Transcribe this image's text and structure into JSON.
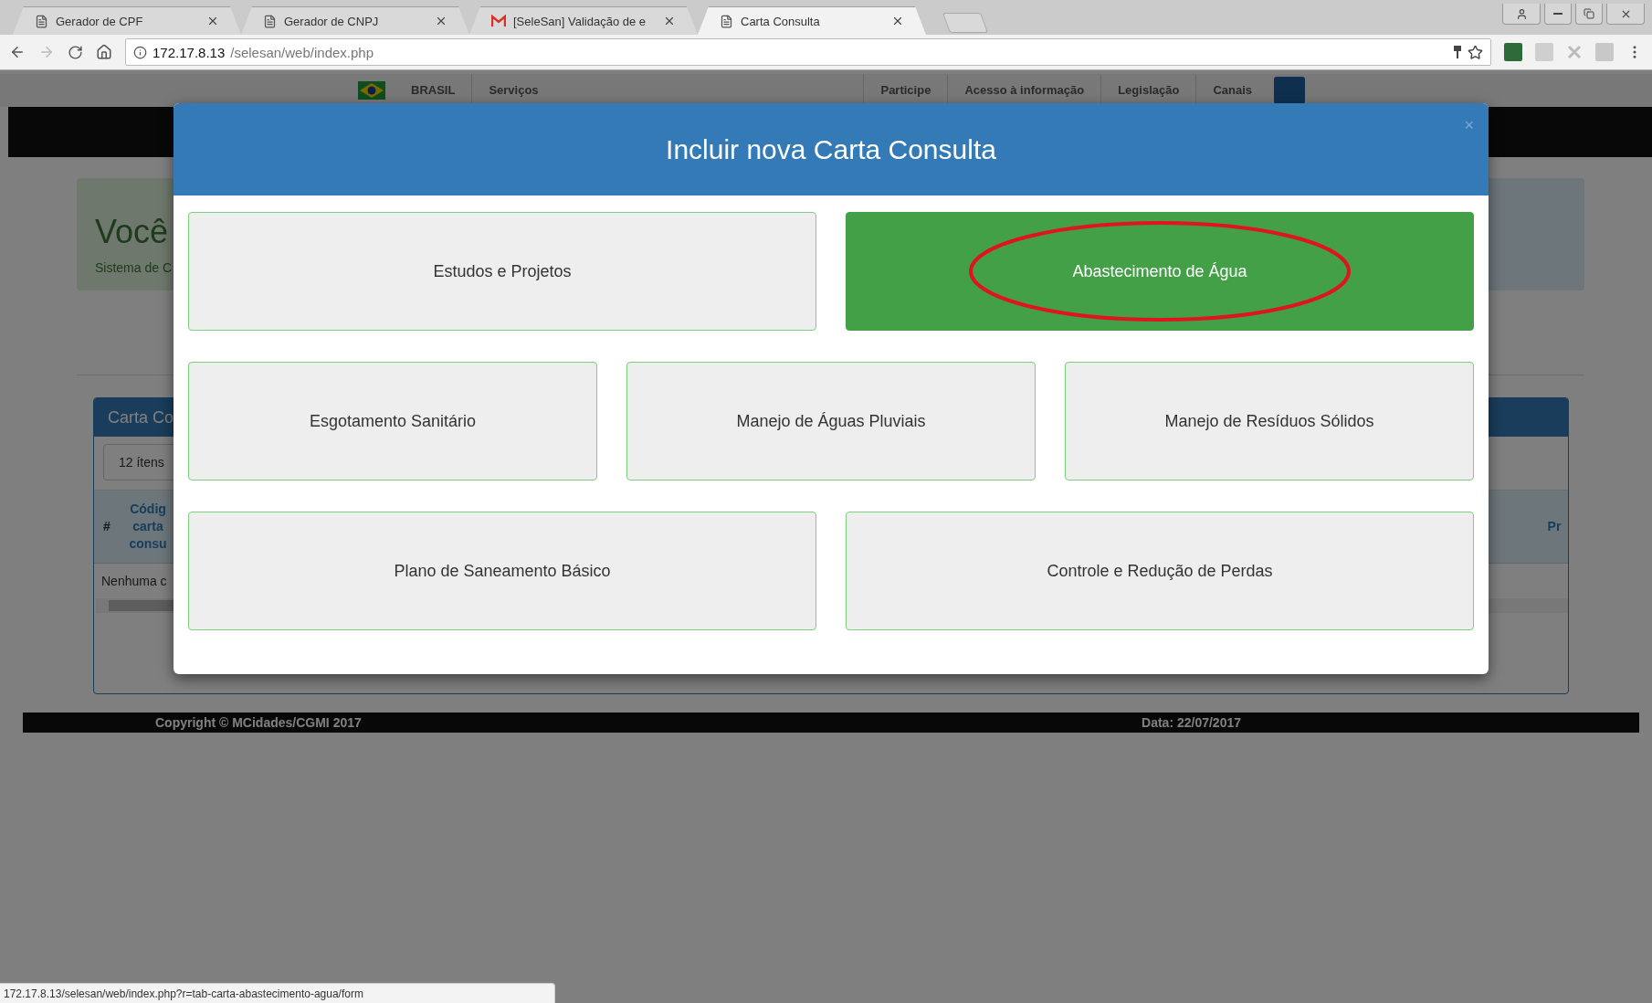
{
  "browser": {
    "tabs": [
      {
        "title": "Gerador de CPF",
        "kind": "page",
        "selected": false
      },
      {
        "title": "Gerador de CNPJ",
        "kind": "page",
        "selected": false
      },
      {
        "title": "[SeleSan] Validação de e",
        "kind": "mail",
        "selected": false
      },
      {
        "title": "Carta Consulta",
        "kind": "page",
        "selected": true
      }
    ],
    "address": {
      "host": "172.17.8.13",
      "path": "/selesan/web/index.php"
    }
  },
  "gov_bar": {
    "brand": "BRASIL",
    "left_links": [
      "Serviços"
    ],
    "right_links": [
      "Participe",
      "Acesso à informação",
      "Legislação",
      "Canais"
    ]
  },
  "page": {
    "welcome": {
      "title": "Você",
      "subtitle": "Sistema de C"
    },
    "panel": {
      "title": "Carta Co",
      "page_size": "12 ítens",
      "columns": [
        "#",
        "Códig carta consu",
        "Pr"
      ],
      "empty_row": "Nenhuma c"
    }
  },
  "footer": {
    "copyright": "Copyright © MCidades/CGMI 2017",
    "date": "Data: 22/07/2017"
  },
  "modal": {
    "title": "Incluir nova Carta Consulta",
    "close": "×",
    "rows": [
      {
        "options": [
          {
            "label": "Estudos e Projetos",
            "selected": false,
            "circled": false
          },
          {
            "label": "Abastecimento de Água",
            "selected": true,
            "circled": true
          }
        ]
      },
      {
        "options": [
          {
            "label": "Esgotamento Sanitário",
            "selected": false,
            "circled": false
          },
          {
            "label": "Manejo de Águas Pluviais",
            "selected": false,
            "circled": false
          },
          {
            "label": "Manejo de Resíduos Sólidos",
            "selected": false,
            "circled": false
          }
        ]
      },
      {
        "options": [
          {
            "label": "Plano de Saneamento Básico",
            "selected": false,
            "circled": false
          },
          {
            "label": "Controle e Redução de Perdas",
            "selected": false,
            "circled": false
          }
        ]
      }
    ]
  },
  "status_bar": "172.17.8.13/selesan/web/index.php?r=tab-carta-abastecimento-agua/form"
}
